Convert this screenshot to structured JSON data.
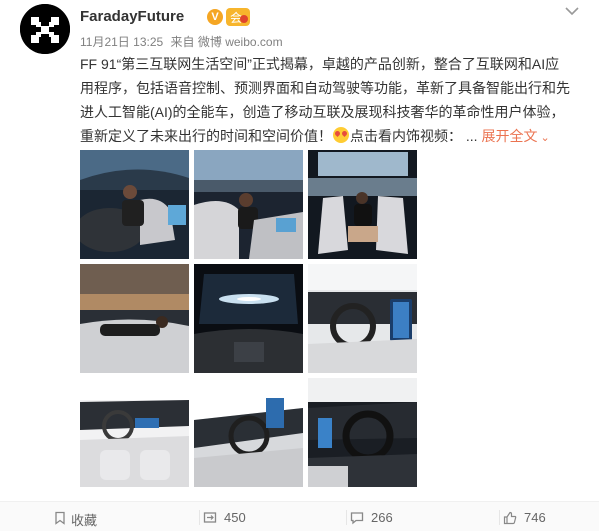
{
  "post": {
    "username": "FaradayFuture",
    "verified_mark": "V",
    "member_mark": "会",
    "timestamp": "11月21日 13:25",
    "source_prefix": "来自",
    "source": "微博 weibo.com",
    "text_before_emoji": "FF 91“第三互联网生活空间”正式揭幕，卓越的产品创新，整合了互联网和AI应用程序，包括语音控制、预测界面和自动驾驶等功能，革新了具备智能出行和先进人工智能(AI)的全能车，创造了移动互联及展现科技奢华的革命性用户体验，重新定义了未来出行的时间和空间价值！",
    "text_after_emoji": "点击看内饰视频：",
    "ellipsis": "...",
    "expand_label": "展开全文",
    "expand_icon": "chevron-down-icon",
    "emoji_icon": "heart-eyes-emoji-icon",
    "avatar_icon": "faraday-future-logo-icon"
  },
  "photos": [
    {
      "name": "photo-1",
      "scene": "woman-reclining-front-seat"
    },
    {
      "name": "photo-2",
      "scene": "passenger-front-seat-panoramic-roof"
    },
    {
      "name": "photo-3",
      "scene": "woman-rear-seat-city-view"
    },
    {
      "name": "photo-4",
      "scene": "man-sleeping-reclined-seat"
    },
    {
      "name": "photo-5",
      "scene": "panoramic-roof-night-sky"
    },
    {
      "name": "photo-6",
      "scene": "steering-wheel-dashboard-screen"
    },
    {
      "name": "photo-7",
      "scene": "white-interior-dashboard-view"
    },
    {
      "name": "photo-8",
      "scene": "steering-wheel-side-view"
    },
    {
      "name": "photo-9",
      "scene": "steering-wheel-dark-interior"
    }
  ],
  "footer": {
    "favorite_label": "收藏",
    "favorite_icon": "bookmark-icon",
    "repost_count": "450",
    "repost_icon": "repost-icon",
    "comment_count": "266",
    "comment_icon": "comment-icon",
    "like_count": "746",
    "like_icon": "thumbs-up-icon"
  },
  "colors": {
    "accent": "#eb7350",
    "text": "#333333",
    "meta": "#808080",
    "footer_bg": "#fafafa"
  }
}
